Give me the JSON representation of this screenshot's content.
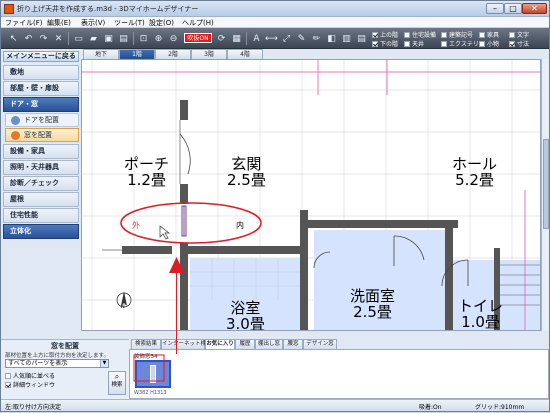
{
  "window": {
    "title": "折り上げ天井を作成する.m3d - 3Dマイホームデザイナー",
    "minimize": "–",
    "maximize": "□",
    "close": "✕"
  },
  "menu": [
    "ファイル(F)",
    "編集(E)",
    "表示(V)",
    "ツール(T)",
    "設定(O)",
    "ヘルプ(H)"
  ],
  "toolbar": {
    "onoff_label": "吹抜ON",
    "options": [
      {
        "label": "上の階",
        "checked": true
      },
      {
        "label": "住宅設備",
        "checked": false
      },
      {
        "label": "建築記号",
        "checked": false
      },
      {
        "label": "家具",
        "checked": false
      },
      {
        "label": "文字",
        "checked": false
      },
      {
        "label": "下の階",
        "checked": true
      },
      {
        "label": "天井",
        "checked": false
      },
      {
        "label": "エクステリア",
        "checked": false
      },
      {
        "label": "小物",
        "checked": false
      },
      {
        "label": "寸法",
        "checked": true
      }
    ]
  },
  "sidebar": {
    "main_menu": "メインメニューに戻る",
    "items": [
      {
        "label": "敷地"
      },
      {
        "label": "部屋・壁・扉設"
      },
      {
        "label": "ドア・窓"
      },
      {
        "label": "ドアを配置"
      },
      {
        "label": "窓を配置"
      },
      {
        "label": "設備・家具"
      },
      {
        "label": "照明・天井器具"
      },
      {
        "label": "診断／チェック"
      },
      {
        "label": "屋根"
      },
      {
        "label": "住宅性能"
      },
      {
        "label": "立体化"
      }
    ]
  },
  "floor_tabs": [
    "地下",
    "1階",
    "2階",
    "3階",
    "4階"
  ],
  "rooms": [
    {
      "name": "ポーチ",
      "size": "1.2畳"
    },
    {
      "name": "玄関",
      "size": "2.5畳"
    },
    {
      "name": "ホール",
      "size": "5.2畳"
    },
    {
      "name": "浴室",
      "size": "3.0畳"
    },
    {
      "name": "洗面室",
      "size": "2.5畳"
    },
    {
      "name": "トイレ",
      "size": "1.0畳"
    }
  ],
  "plan_marks": {
    "outside": "外",
    "inside": "内",
    "north": "N"
  },
  "settings": {
    "title": "窓を配置",
    "description": "部材位置を上方に取付方向を決定します。",
    "select_value": "すべてのパーツを表示",
    "checks": [
      {
        "label": "人気順に並べる",
        "checked": false
      },
      {
        "label": "詳細ウィンドウ",
        "checked": true
      }
    ],
    "search_label": "検索"
  },
  "bottom_tabs": [
    "検索結果",
    "インターネット検索",
    "お気に入り",
    "履歴",
    "棚出し窓",
    "腰窓",
    "デザイン窓"
  ],
  "thumbnail": {
    "name": "装飾窓34",
    "size": "W382 H1313"
  },
  "status": {
    "left": "左:取り付け方向決定",
    "snap": "吸着:On",
    "grid": "グリッド:910mm"
  },
  "colors": {
    "accent": "#2a5297",
    "annotation": "#e01b24",
    "room_highlight": "#d6e3ff"
  }
}
